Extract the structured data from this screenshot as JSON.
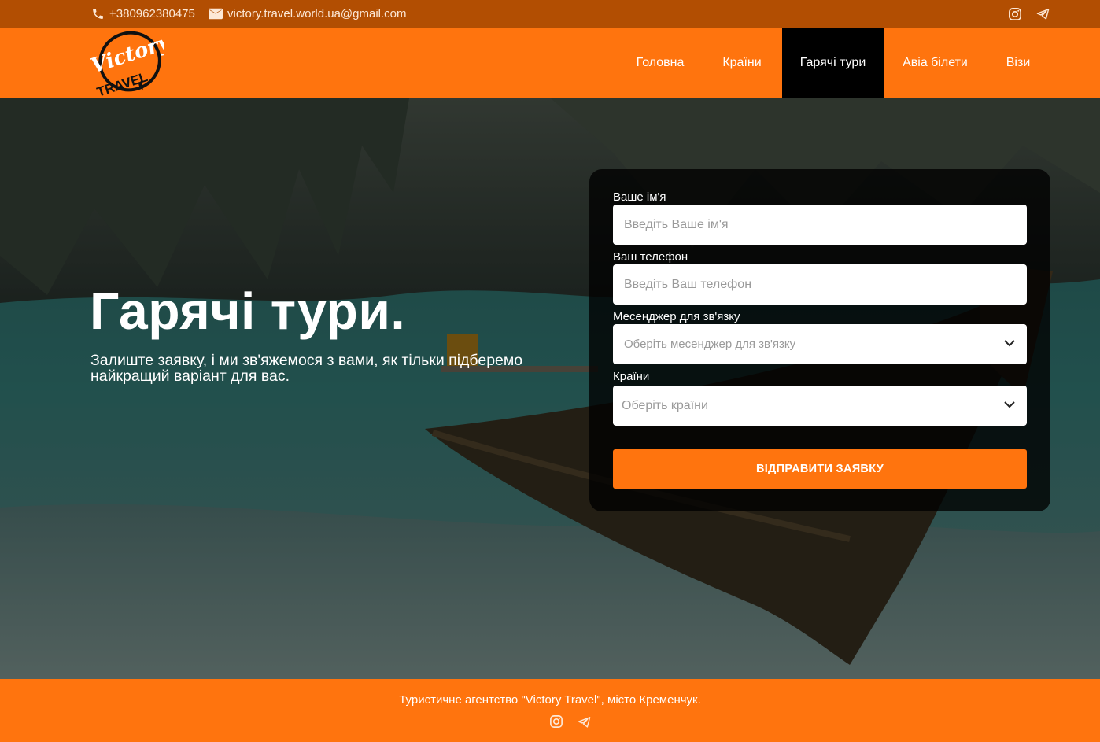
{
  "topbar": {
    "phone": "+380962380475",
    "email": "victory.travel.world.ua@gmail.com",
    "icons": [
      "phone-icon",
      "mail-icon",
      "instagram-icon",
      "telegram-icon"
    ]
  },
  "logo": {
    "line1": "Victory",
    "line2": "TRAVEL"
  },
  "nav": {
    "home": "Головна",
    "countries": "Країни",
    "hot_tours": "Гарячі тури",
    "avia": "Авіа білети",
    "visa": "Візи",
    "active": "hot_tours"
  },
  "hero": {
    "title": "Гарячі тури.",
    "subtitle": "Залиште заявку, і ми зв'яжемося з вами, як тільки підберемо найкращий варіант для вас."
  },
  "form": {
    "name_label": "Ваше ім'я",
    "name_placeholder": "Введіть Ваше ім'я",
    "phone_label": "Ваш телефон",
    "phone_placeholder": "Введіть Ваш телефон",
    "messenger_label": "Месенджер для зв'язку",
    "messenger_placeholder": "Оберіть месенджер для зв'язку",
    "countries_label": "Країни",
    "countries_placeholder": "Оберіть країни",
    "submit": "ВІДПРАВИТИ ЗАЯВКУ"
  },
  "footer": {
    "text": "Туристичне агентство \"Victory Travel\", місто Кременчук."
  },
  "colors": {
    "brand_orange": "#ff740e",
    "topbar_brown": "#b24e02",
    "active_nav": "#000000"
  }
}
